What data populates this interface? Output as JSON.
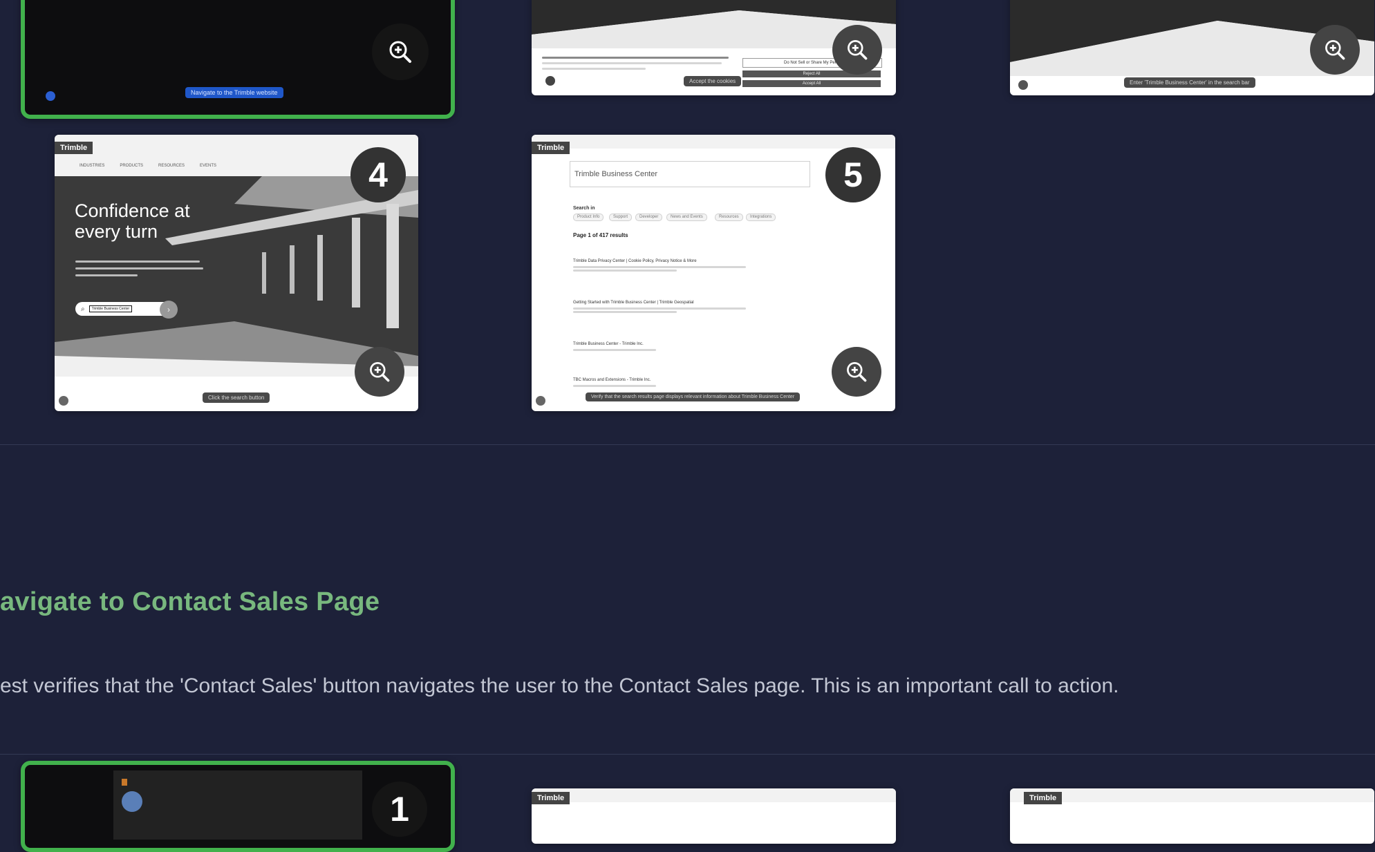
{
  "section": {
    "title": "avigate to Contact Sales Page",
    "description": "est verifies that the 'Contact Sales' button navigates the user to the Contact Sales page. This is an important call to action."
  },
  "cards": {
    "card1": {
      "tooltip": "Navigate to the Trimble website"
    },
    "card2": {
      "tooltip": "Accept the cookies",
      "cookie_buttons": [
        "Do Not Sell or Share My Perso",
        "Reject All",
        "Accept All"
      ]
    },
    "card3": {
      "tooltip": "Enter 'Trimble Business Center' in the search bar"
    },
    "card4": {
      "badge": "4",
      "logo": "Trimble",
      "nav": [
        "INDUSTRIES",
        "PRODUCTS",
        "RESOURCES",
        "EVENTS"
      ],
      "hero_title_line1": "Confidence at",
      "hero_title_line2": "every turn",
      "search_value": "Trimble Business Center",
      "tooltip": "Click the search button"
    },
    "card5": {
      "badge": "5",
      "logo": "Trimble",
      "search_value": "Trimble Business Center",
      "search_in": "Search in",
      "filters": [
        "Product Info",
        "Support",
        "Developer",
        "News and Events",
        "Resources",
        "Integrations"
      ],
      "results_count": "Page 1 of 417 results",
      "results": [
        "Trimble Data Privacy Center | Cookie Policy, Privacy Notice & More",
        "Getting Started with Trimble Business Center | Trimble Geospatial",
        "Trimble Business Center - Trimble Inc.",
        "TBC Macros and Extensions - Trimble Inc."
      ],
      "tooltip": "Verify that the search results page displays relevant information about Trimble Business Center"
    },
    "next_row": {
      "badge": "1",
      "logo": "Trimble"
    }
  },
  "colors": {
    "background": "#1d2139",
    "title_green": "#78b87e",
    "active_border": "#41b14c",
    "tooltip_blue": "#1f57c9"
  },
  "icons": {
    "zoom": "zoom-in-icon"
  }
}
